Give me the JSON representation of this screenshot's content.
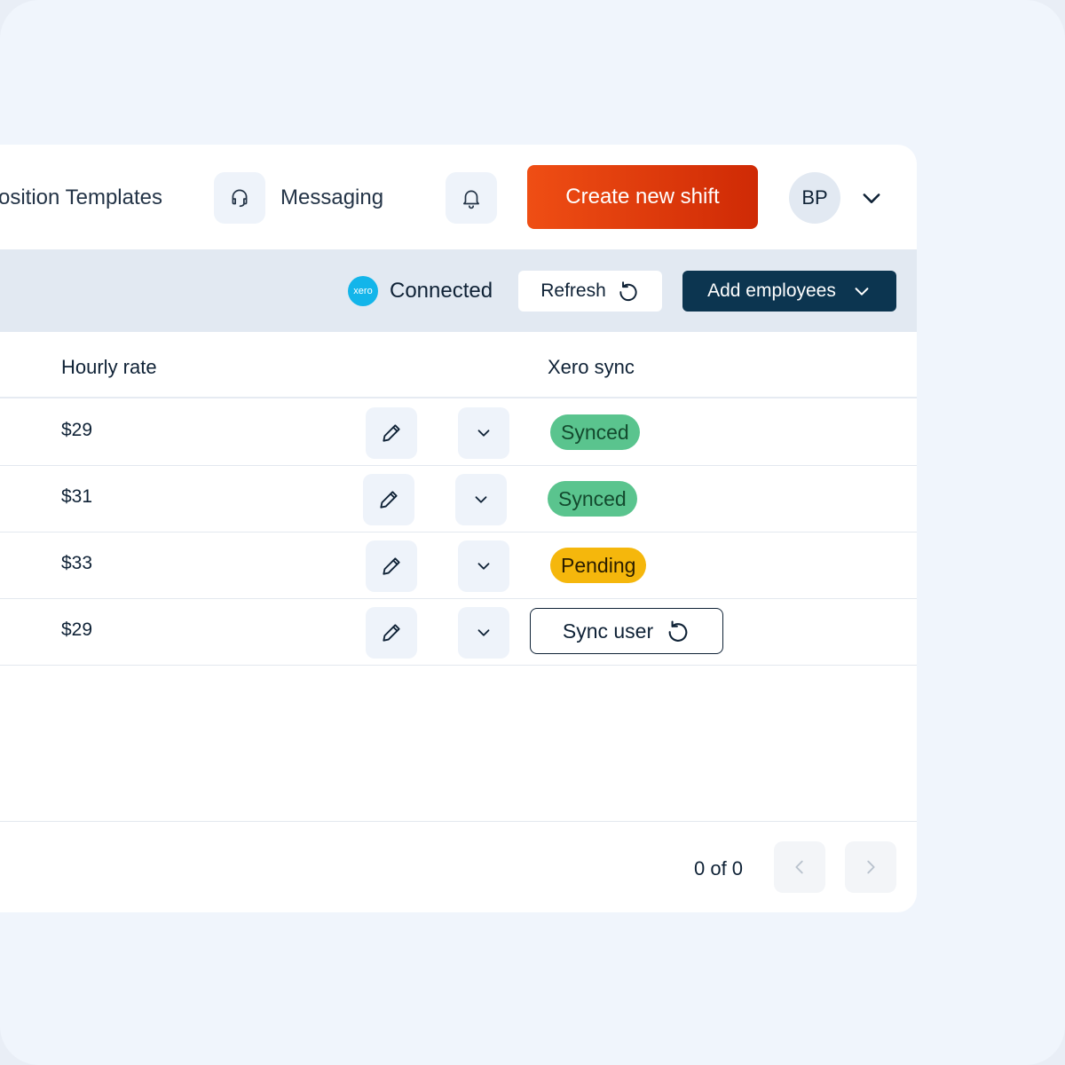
{
  "nav": {
    "position_templates_label": "osition Templates",
    "messaging_label": "Messaging",
    "create_shift_label": "Create new shift",
    "avatar_initials": "BP",
    "icons": [
      "headset-icon",
      "bell-icon",
      "chevron-down-icon"
    ]
  },
  "toolbar": {
    "xero_logo_text": "xero",
    "connection_status": "Connected",
    "refresh_label": "Refresh",
    "add_employees_label": "Add employees"
  },
  "table": {
    "columns": [
      "Hourly rate",
      "Xero sync"
    ],
    "rows": [
      {
        "hourly_rate": "$29",
        "xero_sync": "Synced"
      },
      {
        "hourly_rate": "$31",
        "xero_sync": "Synced"
      },
      {
        "hourly_rate": "$33",
        "xero_sync": "Pending"
      },
      {
        "hourly_rate": "$29",
        "xero_sync": "Sync user"
      }
    ]
  },
  "pagination": {
    "status": "0 of 0"
  },
  "colors": {
    "accent": "#e8420f",
    "primary_dark": "#0c3550",
    "synced": "#5ac48e",
    "pending": "#f5b70c",
    "xero_blue": "#13b5ea"
  }
}
